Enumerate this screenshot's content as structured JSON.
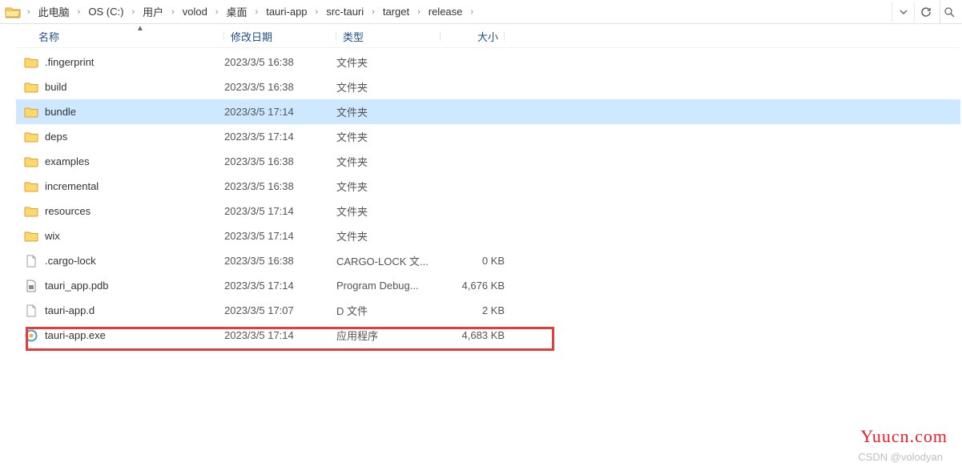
{
  "breadcrumb": [
    "此电脑",
    "OS (C:)",
    "用户",
    "volod",
    "桌面",
    "tauri-app",
    "src-tauri",
    "target",
    "release"
  ],
  "columns": {
    "name": "名称",
    "date": "修改日期",
    "type": "类型",
    "size": "大小"
  },
  "rows": [
    {
      "icon": "folder",
      "name": ".fingerprint",
      "date": "2023/3/5 16:38",
      "type": "文件夹",
      "size": "",
      "sel": false
    },
    {
      "icon": "folder",
      "name": "build",
      "date": "2023/3/5 16:38",
      "type": "文件夹",
      "size": "",
      "sel": false
    },
    {
      "icon": "folder",
      "name": "bundle",
      "date": "2023/3/5 17:14",
      "type": "文件夹",
      "size": "",
      "sel": true
    },
    {
      "icon": "folder",
      "name": "deps",
      "date": "2023/3/5 17:14",
      "type": "文件夹",
      "size": "",
      "sel": false
    },
    {
      "icon": "folder",
      "name": "examples",
      "date": "2023/3/5 16:38",
      "type": "文件夹",
      "size": "",
      "sel": false
    },
    {
      "icon": "folder",
      "name": "incremental",
      "date": "2023/3/5 16:38",
      "type": "文件夹",
      "size": "",
      "sel": false
    },
    {
      "icon": "folder",
      "name": "resources",
      "date": "2023/3/5 17:14",
      "type": "文件夹",
      "size": "",
      "sel": false
    },
    {
      "icon": "folder",
      "name": "wix",
      "date": "2023/3/5 17:14",
      "type": "文件夹",
      "size": "",
      "sel": false
    },
    {
      "icon": "file",
      "name": ".cargo-lock",
      "date": "2023/3/5 16:38",
      "type": "CARGO-LOCK 文...",
      "size": "0 KB",
      "sel": false
    },
    {
      "icon": "pdb",
      "name": "tauri_app.pdb",
      "date": "2023/3/5 17:14",
      "type": "Program Debug...",
      "size": "4,676 KB",
      "sel": false
    },
    {
      "icon": "file",
      "name": "tauri-app.d",
      "date": "2023/3/5 17:07",
      "type": "D 文件",
      "size": "2 KB",
      "sel": false
    },
    {
      "icon": "exe",
      "name": "tauri-app.exe",
      "date": "2023/3/5 17:14",
      "type": "应用程序",
      "size": "4,683 KB",
      "sel": false
    }
  ],
  "watermark": "Yuucn.com",
  "credit": "CSDN @volodyan"
}
